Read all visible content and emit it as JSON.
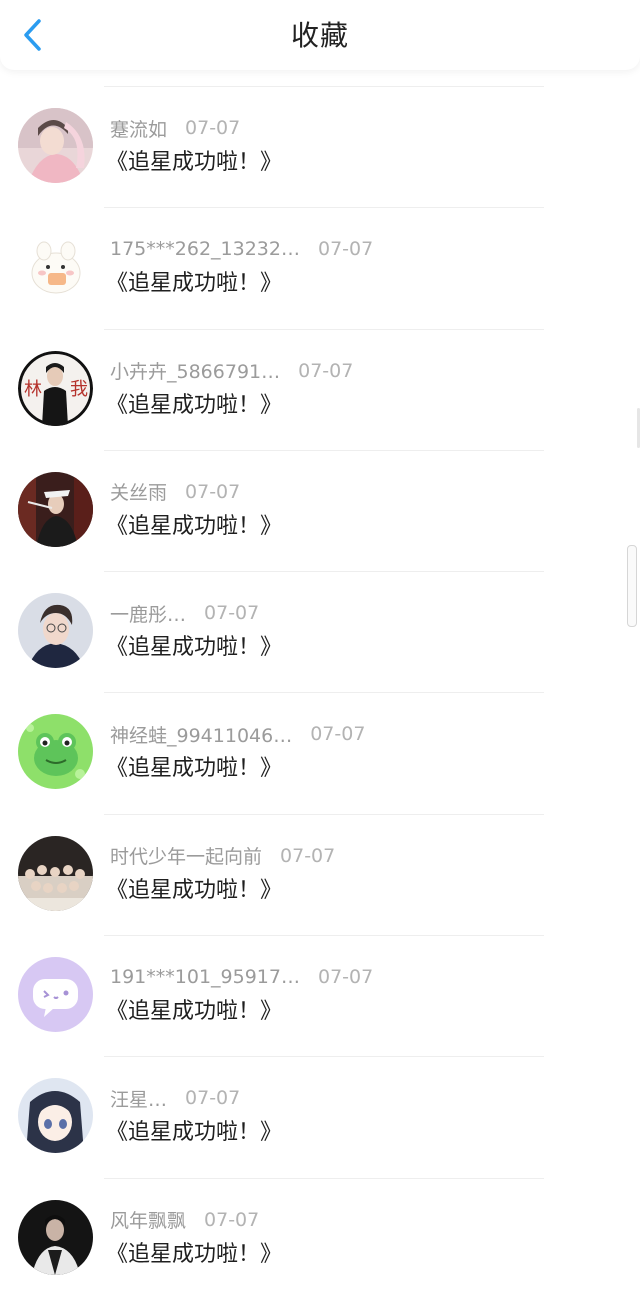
{
  "header": {
    "title": "收藏",
    "back_icon": "chevron-left-icon",
    "accent_color": "#2b9cf0"
  },
  "items": [
    {
      "username": "蹇流如",
      "date": "07-07",
      "content": "《追星成功啦！》",
      "avatar": "photo-girl-pink"
    },
    {
      "username": "175***262_13232…",
      "date": "07-07",
      "content": "《追星成功啦！》",
      "avatar": "cartoon-bunny"
    },
    {
      "username": "小卉卉_5866791…",
      "date": "07-07",
      "content": "《追星成功啦！》",
      "avatar": "photo-man-black-suit"
    },
    {
      "username": "关丝雨",
      "date": "07-07",
      "content": "《追星成功啦！》",
      "avatar": "photo-stage-performer"
    },
    {
      "username": "一鹿彤…",
      "date": "07-07",
      "content": "《追星成功啦！》",
      "avatar": "photo-boy-glasses"
    },
    {
      "username": "神经蛙_99411046…",
      "date": "07-07",
      "content": "《追星成功啦！》",
      "avatar": "cartoon-frog"
    },
    {
      "username": "时代少年一起向前",
      "date": "07-07",
      "content": "《追星成功啦！》",
      "avatar": "photo-group"
    },
    {
      "username": "191***101_95917…",
      "date": "07-07",
      "content": "《追星成功啦！》",
      "avatar": "default-chat-bubble"
    },
    {
      "username": "汪星…",
      "date": "07-07",
      "content": "《追星成功啦！》",
      "avatar": "anime-girl"
    },
    {
      "username": "风年飘飘",
      "date": "07-07",
      "content": "《追星成功啦！》",
      "avatar": "photo-dark-portrait"
    }
  ]
}
